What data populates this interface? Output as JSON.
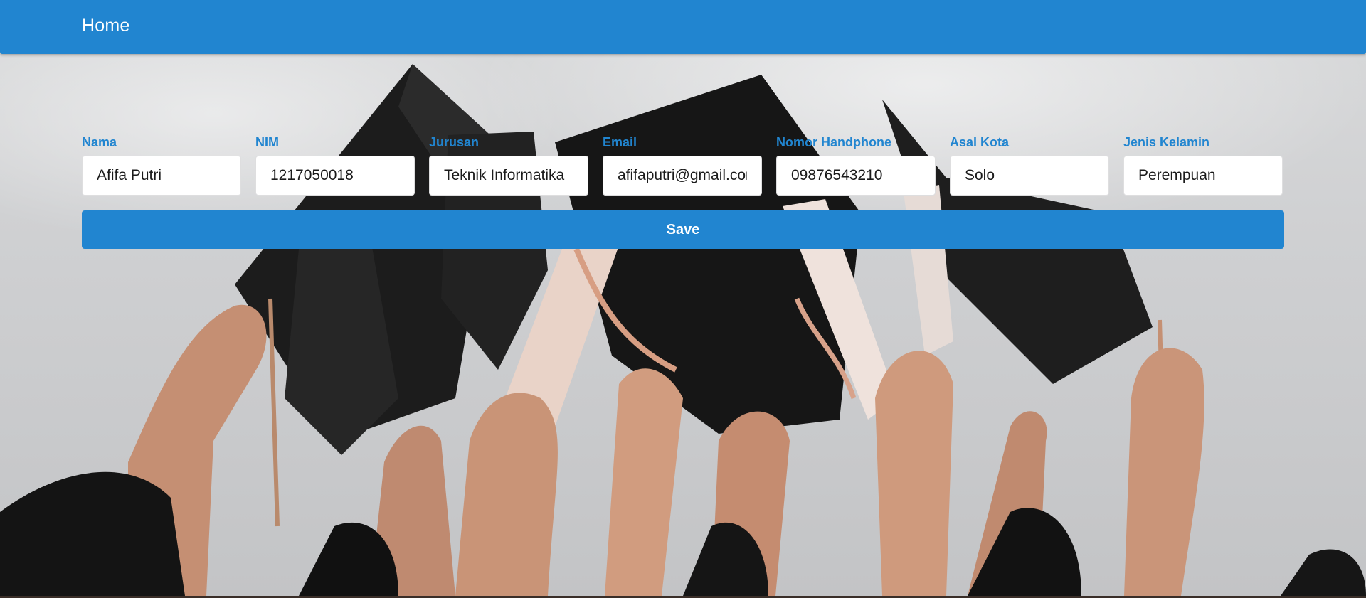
{
  "navbar": {
    "title": "Home"
  },
  "form": {
    "fields": [
      {
        "label": "Nama",
        "value": "Afifa Putri"
      },
      {
        "label": "NIM",
        "value": "1217050018"
      },
      {
        "label": "Jurusan",
        "value": "Teknik Informatika"
      },
      {
        "label": "Email",
        "value": "afifaputri@gmail.com"
      },
      {
        "label": "Nomor Handphone",
        "value": "09876543210"
      },
      {
        "label": "Asal Kota",
        "value": "Solo"
      },
      {
        "label": "Jenis Kelamin",
        "value": "Perempuan"
      }
    ],
    "save_label": "Save"
  },
  "colors": {
    "primary": "#2185d0",
    "label": "#2185d0",
    "background_sky": "#cfd0d2"
  },
  "background": {
    "icon": "graduation-caps-photo"
  }
}
